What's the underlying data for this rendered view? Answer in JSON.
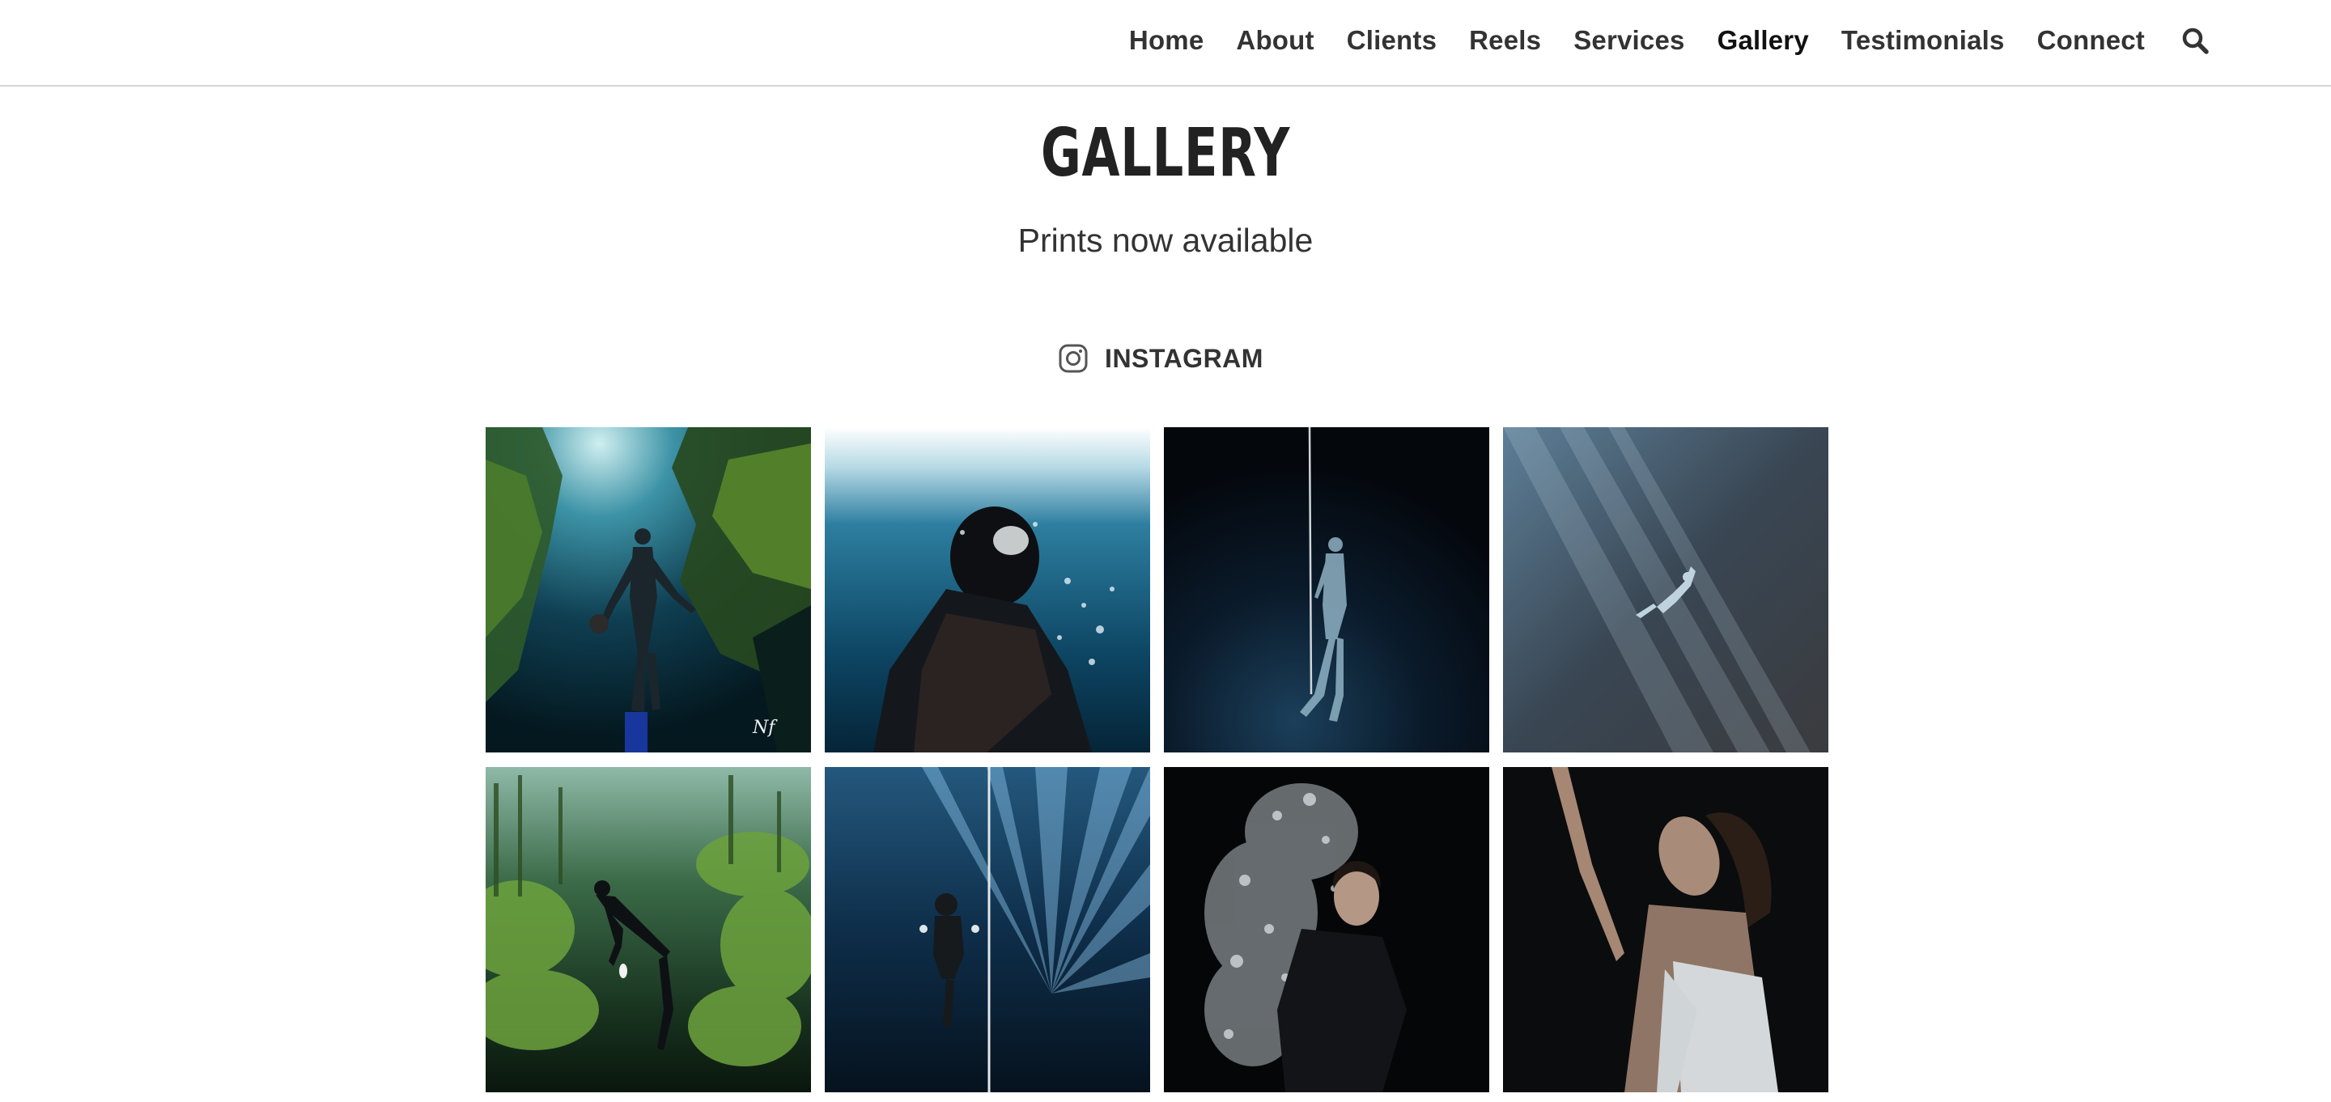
{
  "nav": {
    "items": [
      "Home",
      "About",
      "Clients",
      "Reels",
      "Services",
      "Gallery",
      "Testimonials",
      "Connect"
    ],
    "search_icon": "search-icon"
  },
  "page": {
    "title": "GALLERY",
    "subtitle": "Prints now available"
  },
  "instagram": {
    "icon": "instagram-icon",
    "label": "INSTAGRAM"
  },
  "gallery": {
    "photos": [
      {
        "subject": "freediver in green cenote"
      },
      {
        "subject": "diver looking up at surface"
      },
      {
        "subject": "freediver on rope in dark water"
      },
      {
        "subject": "diver in light rays"
      },
      {
        "subject": "freediver in green kelp canyon"
      },
      {
        "subject": "freediver on line with light rays"
      },
      {
        "subject": "woman in bubbles"
      },
      {
        "subject": "woman in white dress underwater"
      }
    ]
  },
  "colors": {
    "nav_text": "#333333",
    "divider": "#d6d6d6",
    "title": "#222222"
  }
}
